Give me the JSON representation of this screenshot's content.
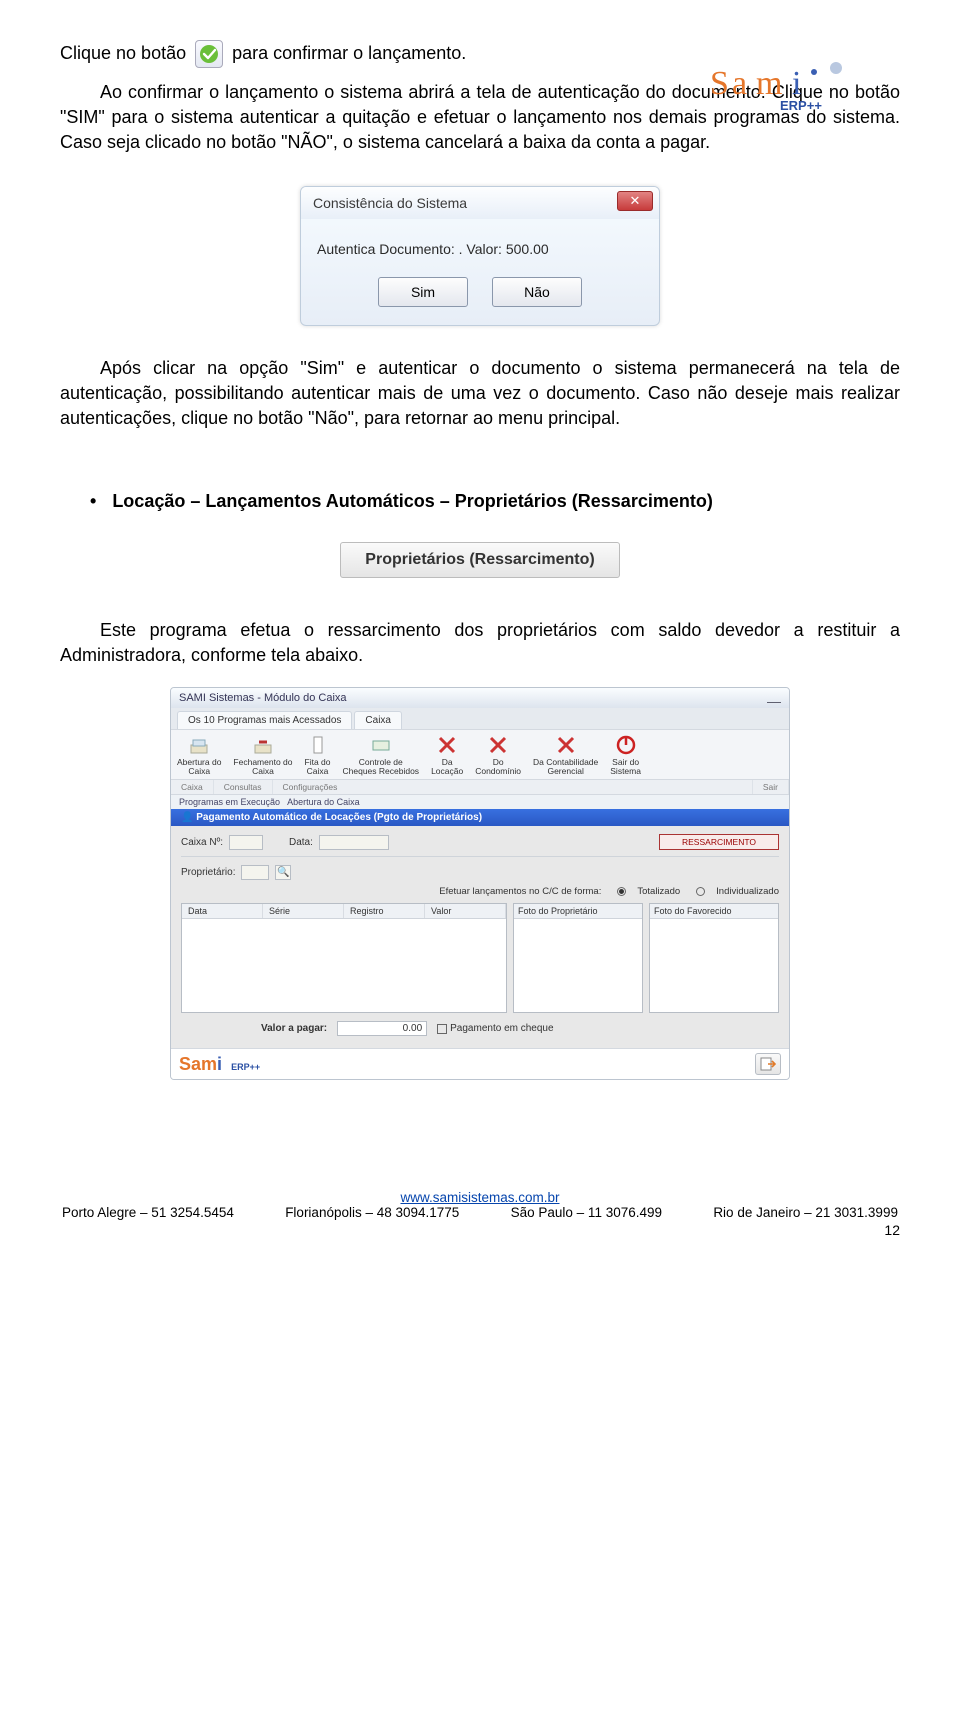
{
  "logo": {
    "brand": "Sami",
    "sub": "ERP++"
  },
  "p1_a": "Clique no botão ",
  "p1_b": " para confirmar o lançamento.",
  "p2": "Ao confirmar o lançamento o sistema abrirá a tela de autenticação do documento. Clique no botão \"SIM\" para o sistema autenticar a quitação e efetuar o lançamento nos demais programas do sistema. Caso seja clicado no botão \"NÃO\", o sistema cancelará a baixa da conta a pagar.",
  "dialog": {
    "title": "Consistência do Sistema",
    "body": "Autentica Documento: . Valor: 500.00",
    "sim": "Sim",
    "nao": "Não"
  },
  "p3": "Após clicar na opção \"Sim\" e autenticar o documento o sistema permanecerá na tela de autenticação, possibilitando autenticar mais de uma vez o documento. Caso não deseje mais realizar autenticações, clique no botão \"Não\", para retornar ao menu principal.",
  "bullet": "Locação – Lançamentos Automáticos – Proprietários (Ressarcimento)",
  "gray_button": "Proprietários (Ressarcimento)",
  "p4": "Este programa efetua o ressarcimento dos proprietários com saldo devedor a restituir a Administradora, conforme tela abaixo.",
  "erp": {
    "title": "SAMI Sistemas - Módulo do Caixa",
    "tabs": [
      "Os 10 Programas mais Acessados",
      "Caixa"
    ],
    "tools": [
      "Abertura do\nCaixa",
      "Fechamento do\nCaixa",
      "Fita do\nCaixa",
      "Controle de\nCheques Recebidos",
      "Da\nLocação",
      "Do\nCondomínio",
      "Da Contabilidade\nGerencial",
      "Sair do\nSistema"
    ],
    "sections": [
      "Caixa",
      "Consultas",
      "Configurações",
      "Sair"
    ],
    "status_left": "Programas em Execução",
    "status_right": "Abertura do Caixa",
    "bluebar": "Pagamento Automático de Locações (Pgto de Proprietários)",
    "caixa_label": "Caixa Nº:",
    "data_label": "Data:",
    "redbox": "RESSARCIMENTO",
    "prop_label": "Proprietário:",
    "efetuar": "Efetuar lançamentos no C/C de forma:",
    "opt_tot": "Totalizado",
    "opt_ind": "Individualizado",
    "grid_cols": [
      "Data",
      "Série",
      "Registro",
      "Valor"
    ],
    "photo1": "Foto do Proprietário",
    "photo2": "Foto do Favorecido",
    "valor_label": "Valor a pagar:",
    "valor_val": "0.00",
    "cheque_label": "Pagamento em cheque"
  },
  "footer": {
    "url": "www.samisistemas.com.br",
    "cities": [
      "Porto Alegre – 51 3254.5454",
      "Florianópolis – 48 3094.1775",
      "São Paulo – 11 3076.499",
      "Rio de Janeiro – 21 3031.3999"
    ],
    "page": "12"
  }
}
